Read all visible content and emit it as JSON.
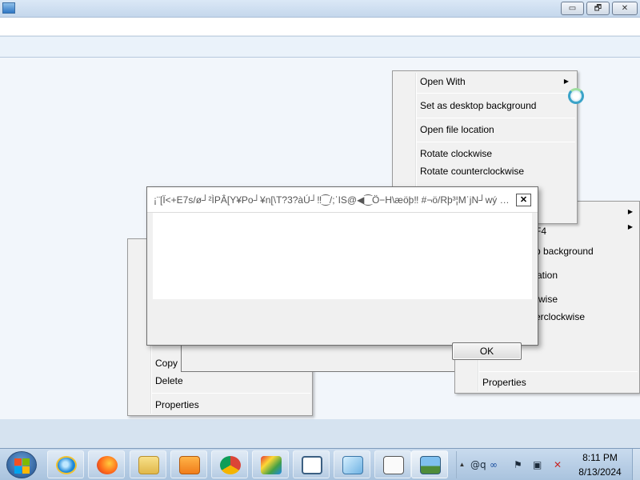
{
  "window": {
    "minimize_glyph": "▭",
    "maximize_glyph": "🗗",
    "close_glyph": "✕"
  },
  "context_menu_top": {
    "items": [
      "Open With",
      "Set as desktop background",
      "Open file location",
      "Rotate clockwise",
      "Rotate counterclockwise"
    ],
    "submenu_arrow": "▶"
  },
  "context_menu_right": {
    "partial_items": [
      "F4",
      "p background",
      "ation",
      "wise",
      "erclockwise"
    ],
    "properties": "Properties",
    "submenu_arrow": "▶"
  },
  "context_menu_left": {
    "items": [
      "Copy",
      "Delete",
      "Properties"
    ]
  },
  "dialog": {
    "title": "¡¨[Ï<+E7s/ø┘²ÌPÂ[Y¥Po┘¥n[\\T?3?àÚ┘‼⁐/;ˈIS@◀⁐Ö−H\\æöþ‼ #¬ö/Rþ³¦MˈjN┘wý Ýæ...",
    "close_glyph": "✕"
  },
  "ok_button": {
    "label": "OK"
  },
  "taskbar": {
    "apps": [
      "internet-explorer",
      "firefox",
      "file-explorer",
      "media-player",
      "chrome",
      "paint",
      "app-window",
      "notepad",
      "document",
      "photo-viewer"
    ],
    "tray_chevron": "▲",
    "tray_icons": [
      "@q",
      "∞",
      "⚑",
      "▣",
      "✕"
    ],
    "time": "8:11 PM",
    "date": "8/13/2024"
  },
  "colors": {
    "taskbar": "#b5cce4",
    "menu_bg": "#f1f1f1",
    "desktop": "#d6e3f0"
  }
}
